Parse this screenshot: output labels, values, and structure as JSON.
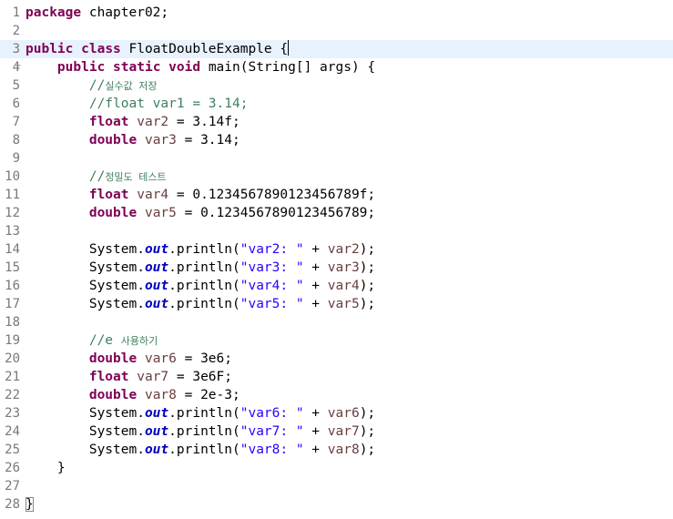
{
  "editor": {
    "language": "java",
    "current_line": 3,
    "colors": {
      "keyword": "#7f0055",
      "comment": "#3f7f5f",
      "string": "#2a00ff",
      "static_field": "#0000c0",
      "local_variable": "#6a3e3e",
      "line_number": "#787878",
      "current_line_highlight": "#e8f2fe"
    },
    "lines": [
      {
        "num": "1",
        "tokens": [
          {
            "t": "kw",
            "v": "package"
          },
          {
            "t": "pl",
            "v": " chapter02;"
          }
        ]
      },
      {
        "num": "2",
        "tokens": []
      },
      {
        "num": "3",
        "tokens": [
          {
            "t": "kw",
            "v": "public"
          },
          {
            "t": "pl",
            "v": " "
          },
          {
            "t": "kw",
            "v": "class"
          },
          {
            "t": "pl",
            "v": " FloatDoubleExample {"
          },
          {
            "t": "caret",
            "v": ""
          }
        ]
      },
      {
        "num": "4",
        "fold": "−",
        "tokens": [
          {
            "t": "pl",
            "v": "    "
          },
          {
            "t": "kw",
            "v": "public"
          },
          {
            "t": "pl",
            "v": " "
          },
          {
            "t": "kw",
            "v": "static"
          },
          {
            "t": "pl",
            "v": " "
          },
          {
            "t": "kw",
            "v": "void"
          },
          {
            "t": "pl",
            "v": " main(String[] args) {"
          }
        ]
      },
      {
        "num": "5",
        "tokens": [
          {
            "t": "pl",
            "v": "        "
          },
          {
            "t": "cm",
            "v": "//"
          },
          {
            "t": "cm-ko",
            "v": "실수값 저장"
          }
        ]
      },
      {
        "num": "6",
        "tokens": [
          {
            "t": "pl",
            "v": "        "
          },
          {
            "t": "cm",
            "v": "//float var1 = 3.14;"
          }
        ]
      },
      {
        "num": "7",
        "tokens": [
          {
            "t": "pl",
            "v": "        "
          },
          {
            "t": "kw",
            "v": "float"
          },
          {
            "t": "pl",
            "v": " "
          },
          {
            "t": "var",
            "v": "var2"
          },
          {
            "t": "pl",
            "v": " = 3.14f;"
          }
        ]
      },
      {
        "num": "8",
        "tokens": [
          {
            "t": "pl",
            "v": "        "
          },
          {
            "t": "kw",
            "v": "double"
          },
          {
            "t": "pl",
            "v": " "
          },
          {
            "t": "var",
            "v": "var3"
          },
          {
            "t": "pl",
            "v": " = 3.14;"
          }
        ]
      },
      {
        "num": "9",
        "tokens": []
      },
      {
        "num": "10",
        "tokens": [
          {
            "t": "pl",
            "v": "        "
          },
          {
            "t": "cm",
            "v": "//"
          },
          {
            "t": "cm-ko",
            "v": "정밀도 테스트"
          }
        ]
      },
      {
        "num": "11",
        "tokens": [
          {
            "t": "pl",
            "v": "        "
          },
          {
            "t": "kw",
            "v": "float"
          },
          {
            "t": "pl",
            "v": " "
          },
          {
            "t": "var",
            "v": "var4"
          },
          {
            "t": "pl",
            "v": " = 0.1234567890123456789f;"
          }
        ]
      },
      {
        "num": "12",
        "tokens": [
          {
            "t": "pl",
            "v": "        "
          },
          {
            "t": "kw",
            "v": "double"
          },
          {
            "t": "pl",
            "v": " "
          },
          {
            "t": "var",
            "v": "var5"
          },
          {
            "t": "pl",
            "v": " = 0.1234567890123456789;"
          }
        ]
      },
      {
        "num": "13",
        "tokens": []
      },
      {
        "num": "14",
        "tokens": [
          {
            "t": "pl",
            "v": "        System."
          },
          {
            "t": "fld",
            "v": "out"
          },
          {
            "t": "pl",
            "v": ".println("
          },
          {
            "t": "str",
            "v": "\"var2: \""
          },
          {
            "t": "pl",
            "v": " + "
          },
          {
            "t": "var",
            "v": "var2"
          },
          {
            "t": "pl",
            "v": ");"
          }
        ]
      },
      {
        "num": "15",
        "tokens": [
          {
            "t": "pl",
            "v": "        System."
          },
          {
            "t": "fld",
            "v": "out"
          },
          {
            "t": "pl",
            "v": ".println("
          },
          {
            "t": "str",
            "v": "\"var3: \""
          },
          {
            "t": "pl",
            "v": " + "
          },
          {
            "t": "var",
            "v": "var3"
          },
          {
            "t": "pl",
            "v": ");"
          }
        ]
      },
      {
        "num": "16",
        "tokens": [
          {
            "t": "pl",
            "v": "        System."
          },
          {
            "t": "fld",
            "v": "out"
          },
          {
            "t": "pl",
            "v": ".println("
          },
          {
            "t": "str",
            "v": "\"var4: \""
          },
          {
            "t": "pl",
            "v": " + "
          },
          {
            "t": "var",
            "v": "var4"
          },
          {
            "t": "pl",
            "v": ");"
          }
        ]
      },
      {
        "num": "17",
        "tokens": [
          {
            "t": "pl",
            "v": "        System."
          },
          {
            "t": "fld",
            "v": "out"
          },
          {
            "t": "pl",
            "v": ".println("
          },
          {
            "t": "str",
            "v": "\"var5: \""
          },
          {
            "t": "pl",
            "v": " + "
          },
          {
            "t": "var",
            "v": "var5"
          },
          {
            "t": "pl",
            "v": ");"
          }
        ]
      },
      {
        "num": "18",
        "tokens": []
      },
      {
        "num": "19",
        "tokens": [
          {
            "t": "pl",
            "v": "        "
          },
          {
            "t": "cm",
            "v": "//e "
          },
          {
            "t": "cm-ko",
            "v": "사용하기"
          }
        ]
      },
      {
        "num": "20",
        "tokens": [
          {
            "t": "pl",
            "v": "        "
          },
          {
            "t": "kw",
            "v": "double"
          },
          {
            "t": "pl",
            "v": " "
          },
          {
            "t": "var",
            "v": "var6"
          },
          {
            "t": "pl",
            "v": " = 3e6;"
          }
        ]
      },
      {
        "num": "21",
        "tokens": [
          {
            "t": "pl",
            "v": "        "
          },
          {
            "t": "kw",
            "v": "float"
          },
          {
            "t": "pl",
            "v": " "
          },
          {
            "t": "var",
            "v": "var7"
          },
          {
            "t": "pl",
            "v": " = 3e6F;"
          }
        ]
      },
      {
        "num": "22",
        "tokens": [
          {
            "t": "pl",
            "v": "        "
          },
          {
            "t": "kw",
            "v": "double"
          },
          {
            "t": "pl",
            "v": " "
          },
          {
            "t": "var",
            "v": "var8"
          },
          {
            "t": "pl",
            "v": " = 2e-3;"
          }
        ]
      },
      {
        "num": "23",
        "tokens": [
          {
            "t": "pl",
            "v": "        System."
          },
          {
            "t": "fld",
            "v": "out"
          },
          {
            "t": "pl",
            "v": ".println("
          },
          {
            "t": "str",
            "v": "\"var6: \""
          },
          {
            "t": "pl",
            "v": " + "
          },
          {
            "t": "var",
            "v": "var6"
          },
          {
            "t": "pl",
            "v": ");"
          }
        ]
      },
      {
        "num": "24",
        "tokens": [
          {
            "t": "pl",
            "v": "        System."
          },
          {
            "t": "fld",
            "v": "out"
          },
          {
            "t": "pl",
            "v": ".println("
          },
          {
            "t": "str",
            "v": "\"var7: \""
          },
          {
            "t": "pl",
            "v": " + "
          },
          {
            "t": "var",
            "v": "var7"
          },
          {
            "t": "pl",
            "v": ");"
          }
        ]
      },
      {
        "num": "25",
        "tokens": [
          {
            "t": "pl",
            "v": "        System."
          },
          {
            "t": "fld",
            "v": "out"
          },
          {
            "t": "pl",
            "v": ".println("
          },
          {
            "t": "str",
            "v": "\"var8: \""
          },
          {
            "t": "pl",
            "v": " + "
          },
          {
            "t": "var",
            "v": "var8"
          },
          {
            "t": "pl",
            "v": ");"
          }
        ]
      },
      {
        "num": "26",
        "tokens": [
          {
            "t": "pl",
            "v": "    }"
          }
        ]
      },
      {
        "num": "27",
        "tokens": []
      },
      {
        "num": "28",
        "tokens": [
          {
            "t": "boxed",
            "v": "}"
          }
        ]
      }
    ]
  }
}
